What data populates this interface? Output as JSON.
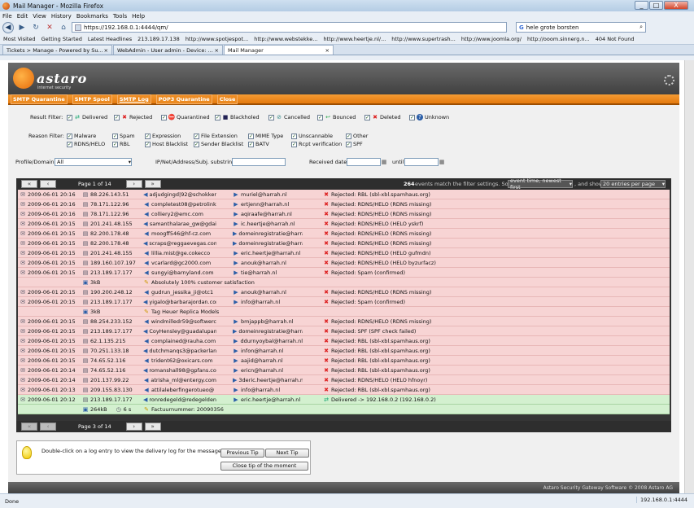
{
  "window": {
    "title": "Mail Manager - Mozilla Firefox",
    "min": "_",
    "max": "□",
    "close": "X"
  },
  "menu": [
    "File",
    "Edit",
    "View",
    "History",
    "Bookmarks",
    "Tools",
    "Help"
  ],
  "nav": {
    "url": "https://192.168.0.1:4444/qm/",
    "search": "hele grote borsten"
  },
  "bookmarks": [
    "Most Visited",
    "Getting Started",
    "Latest Headlines",
    "213.189.17.138",
    "http://www.spotjespot...",
    "http://www.webstekke...",
    "http://www.heertje.nl/...",
    "http://www.supertrash...",
    "http://www.joomla.org/",
    "http://ooom.sinnerg.n...",
    "404 Not Found"
  ],
  "tabs": [
    {
      "label": "Tickets > Manage - Powered by Su..."
    },
    {
      "label": "WebAdmin - User admin - Device: ..."
    },
    {
      "label": "Mail Manager"
    }
  ],
  "app": {
    "logo": "astaro",
    "logo_sub": "internet security",
    "nav": [
      "SMTP Quarantine",
      "SMTP Spool",
      "SMTP Log",
      "POP3 Quarantine",
      "Close"
    ]
  },
  "filters": {
    "result_label": "Result Filter:",
    "result": [
      "Delivered",
      "Rejected",
      "Quarantined",
      "Blackholed",
      "Cancelled",
      "Bounced",
      "Deleted",
      "Unknown"
    ],
    "reason_label": "Reason Filter:",
    "reason_row1": [
      "Malware",
      "Spam",
      "Expression",
      "File Extension",
      "MIME Type",
      "Unscannable",
      "Other"
    ],
    "reason_row2": [
      "RDNS/HELO",
      "RBL",
      "Host Blacklist",
      "Sender Blacklist",
      "BATV",
      "Rcpt verification",
      "SPF"
    ],
    "profile_label": "Profile/Domain:",
    "profile_value": "All",
    "ip_label": "IP/Net/Address/Subj. substring:",
    "received_label": "Received date:",
    "until_label": "until"
  },
  "grid": {
    "page_top": "Page 1 of 14",
    "page_bottom": "Page 3 of 14",
    "match_count": "264",
    "match_text": "events match the filter settings. Sort by",
    "sort_value": "event time, newest first",
    "show_text": ", and show",
    "show_value": "20 entries per page",
    "rows": [
      {
        "time": "2009-06-01 20:16",
        "ip": "88.226.143.51",
        "from": "adjudgingd|92@schokker",
        "to": "muriel@harrah.nl",
        "status": "Rejected: RBL (sbl-xbl.spamhaus.org)",
        "type": "red"
      },
      {
        "time": "2009-06-01 20:16",
        "ip": "78.171.122.96",
        "from": "completest08@petrolink",
        "to": "ertjenn@harrah.nl",
        "status": "Rejected: RDNS/HELO (RDNS missing)",
        "type": "red"
      },
      {
        "time": "2009-06-01 20:16",
        "ip": "78.171.122.96",
        "from": "colliery2@emc.com",
        "to": "aqiraafe@harrah.nl",
        "status": "Rejected: RDNS/HELO (RDNS missing)",
        "type": "red"
      },
      {
        "time": "2009-06-01 20:15",
        "ip": "201.241.48.155",
        "from": "samanthalarae_gw@gdai",
        "to": "ic.heertje@harrah.nl",
        "status": "Rejected: RDNS/HELO (HELO yskrf)",
        "type": "red"
      },
      {
        "time": "2009-06-01 20:15",
        "ip": "82.200.178.48",
        "from": "moogff546@hf-cz.com",
        "to": "domeinregistratie@harrah",
        "status": "Rejected: RDNS/HELO (RDNS missing)",
        "type": "red"
      },
      {
        "time": "2009-06-01 20:15",
        "ip": "82.200.178.48",
        "from": "scraps@reggaevegas.com",
        "to": "domeinregistratie@harrah",
        "status": "Rejected: RDNS/HELO (RDNS missing)",
        "type": "red"
      },
      {
        "time": "2009-06-01 20:15",
        "ip": "201.241.48.155",
        "from": "lillia.mist@ge.cokecco",
        "to": "eric.heertje@harrah.nl",
        "status": "Rejected: RDNS/HELO (HELO gufmdn)",
        "type": "red"
      },
      {
        "time": "2009-06-01 20:15",
        "ip": "189.160.107.197",
        "from": "vcarlard@gc2000.com",
        "to": "anouk@harrah.nl",
        "status": "Rejected: RDNS/HELO (HELO byzurfacz)",
        "type": "red"
      },
      {
        "time": "2009-06-01 20:15",
        "ip": "213.189.17.177",
        "from": "sungyi@barnyland.com",
        "to": "tie@harrah.nl",
        "status": "Rejected: Spam (confirmed)",
        "type": "red",
        "size": "3kB",
        "subject": "Absolutely 100% customer satisfaction"
      },
      {
        "time": "2009-06-01 20:15",
        "ip": "190.200.248.12",
        "from": "gudrun_jessika_ji@otc1",
        "to": "anouk@harrah.nl",
        "status": "Rejected: RDNS/HELO (RDNS missing)",
        "type": "red"
      },
      {
        "time": "2009-06-01 20:15",
        "ip": "213.189.17.177",
        "from": "yigalo@barbarajordan.com",
        "to": "info@harrah.nl",
        "status": "Rejected: Spam (confirmed)",
        "type": "red",
        "size": "3kB",
        "subject": "Tag Heuer Replica Models"
      },
      {
        "time": "2009-06-01 20:15",
        "ip": "88.254.233.152",
        "from": "windmilledr59@softwerc",
        "to": "bmjappb@harrah.nl",
        "status": "Rejected: RDNS/HELO (RDNS missing)",
        "type": "red"
      },
      {
        "time": "2009-06-01 20:15",
        "ip": "213.189.17.177",
        "from": "CoyHensley@guadalupano",
        "to": "domeinregistratie@harrah",
        "status": "Rejected: SPF (SPF check failed)",
        "type": "red"
      },
      {
        "time": "2009-06-01 20:15",
        "ip": "62.1.135.215",
        "from": "complained@rauha.com",
        "to": "ddurnyoybal@harrah.nl",
        "status": "Rejected: RBL (sbl-xbl.spamhaus.org)",
        "type": "red"
      },
      {
        "time": "2009-06-01 20:15",
        "ip": "70.251.133.18",
        "from": "dutchmanqs3@packerland",
        "to": "infon@harrah.nl",
        "status": "Rejected: RBL (sbl-xbl.spamhaus.org)",
        "type": "red"
      },
      {
        "time": "2009-06-01 20:15",
        "ip": "74.65.52.116",
        "from": "trident62@oxicars.com",
        "to": "aajid@harrah.nl",
        "status": "Rejected: RBL (sbl-xbl.spamhaus.org)",
        "type": "red"
      },
      {
        "time": "2009-06-01 20:14",
        "ip": "74.65.52.116",
        "from": "romanshall98@gpfans.com",
        "to": "ericn@harrah.nl",
        "status": "Rejected: RBL (sbl-xbl.spamhaus.org)",
        "type": "red"
      },
      {
        "time": "2009-06-01 20:14",
        "ip": "201.137.99.22",
        "from": "atrisha_ml@entergy.com",
        "to": "3deric.heertje@harrah.nl",
        "status": "Rejected: RDNS/HELO (HELO hfnoyr)",
        "type": "red"
      },
      {
        "time": "2009-06-01 20:13",
        "ip": "209.155.83.130",
        "from": "attilaleberfingerotueo@",
        "to": "info@harrah.nl",
        "status": "Rejected: RBL (sbl-xbl.spamhaus.org)",
        "type": "red"
      },
      {
        "time": "2009-06-01 20:12",
        "ip": "213.189.17.177",
        "from": "ronredegeld@redegelden",
        "to": "eric.heertje@harrah.nl",
        "status": "Delivered -> 192.168.0.2 (192.168.0.2)",
        "type": "green",
        "size": "264kB",
        "delay": "6 s",
        "subject": "Factuurnummer: 20090356"
      }
    ]
  },
  "tip": {
    "text": "Double-click on a log entry to view the delivery log for the message.",
    "prev": "Previous Tip",
    "next": "Next Tip",
    "close": "Close tip of the moment"
  },
  "footer": "Astaro Security Gateway Software © 2008 Astaro AG",
  "status": {
    "left": "Done",
    "right": "192.168.0.1:4444"
  },
  "colors": {
    "accent": "#e47a0e",
    "rejected_row": "#f7d4d4",
    "delivered_row": "#d3f0cf"
  }
}
